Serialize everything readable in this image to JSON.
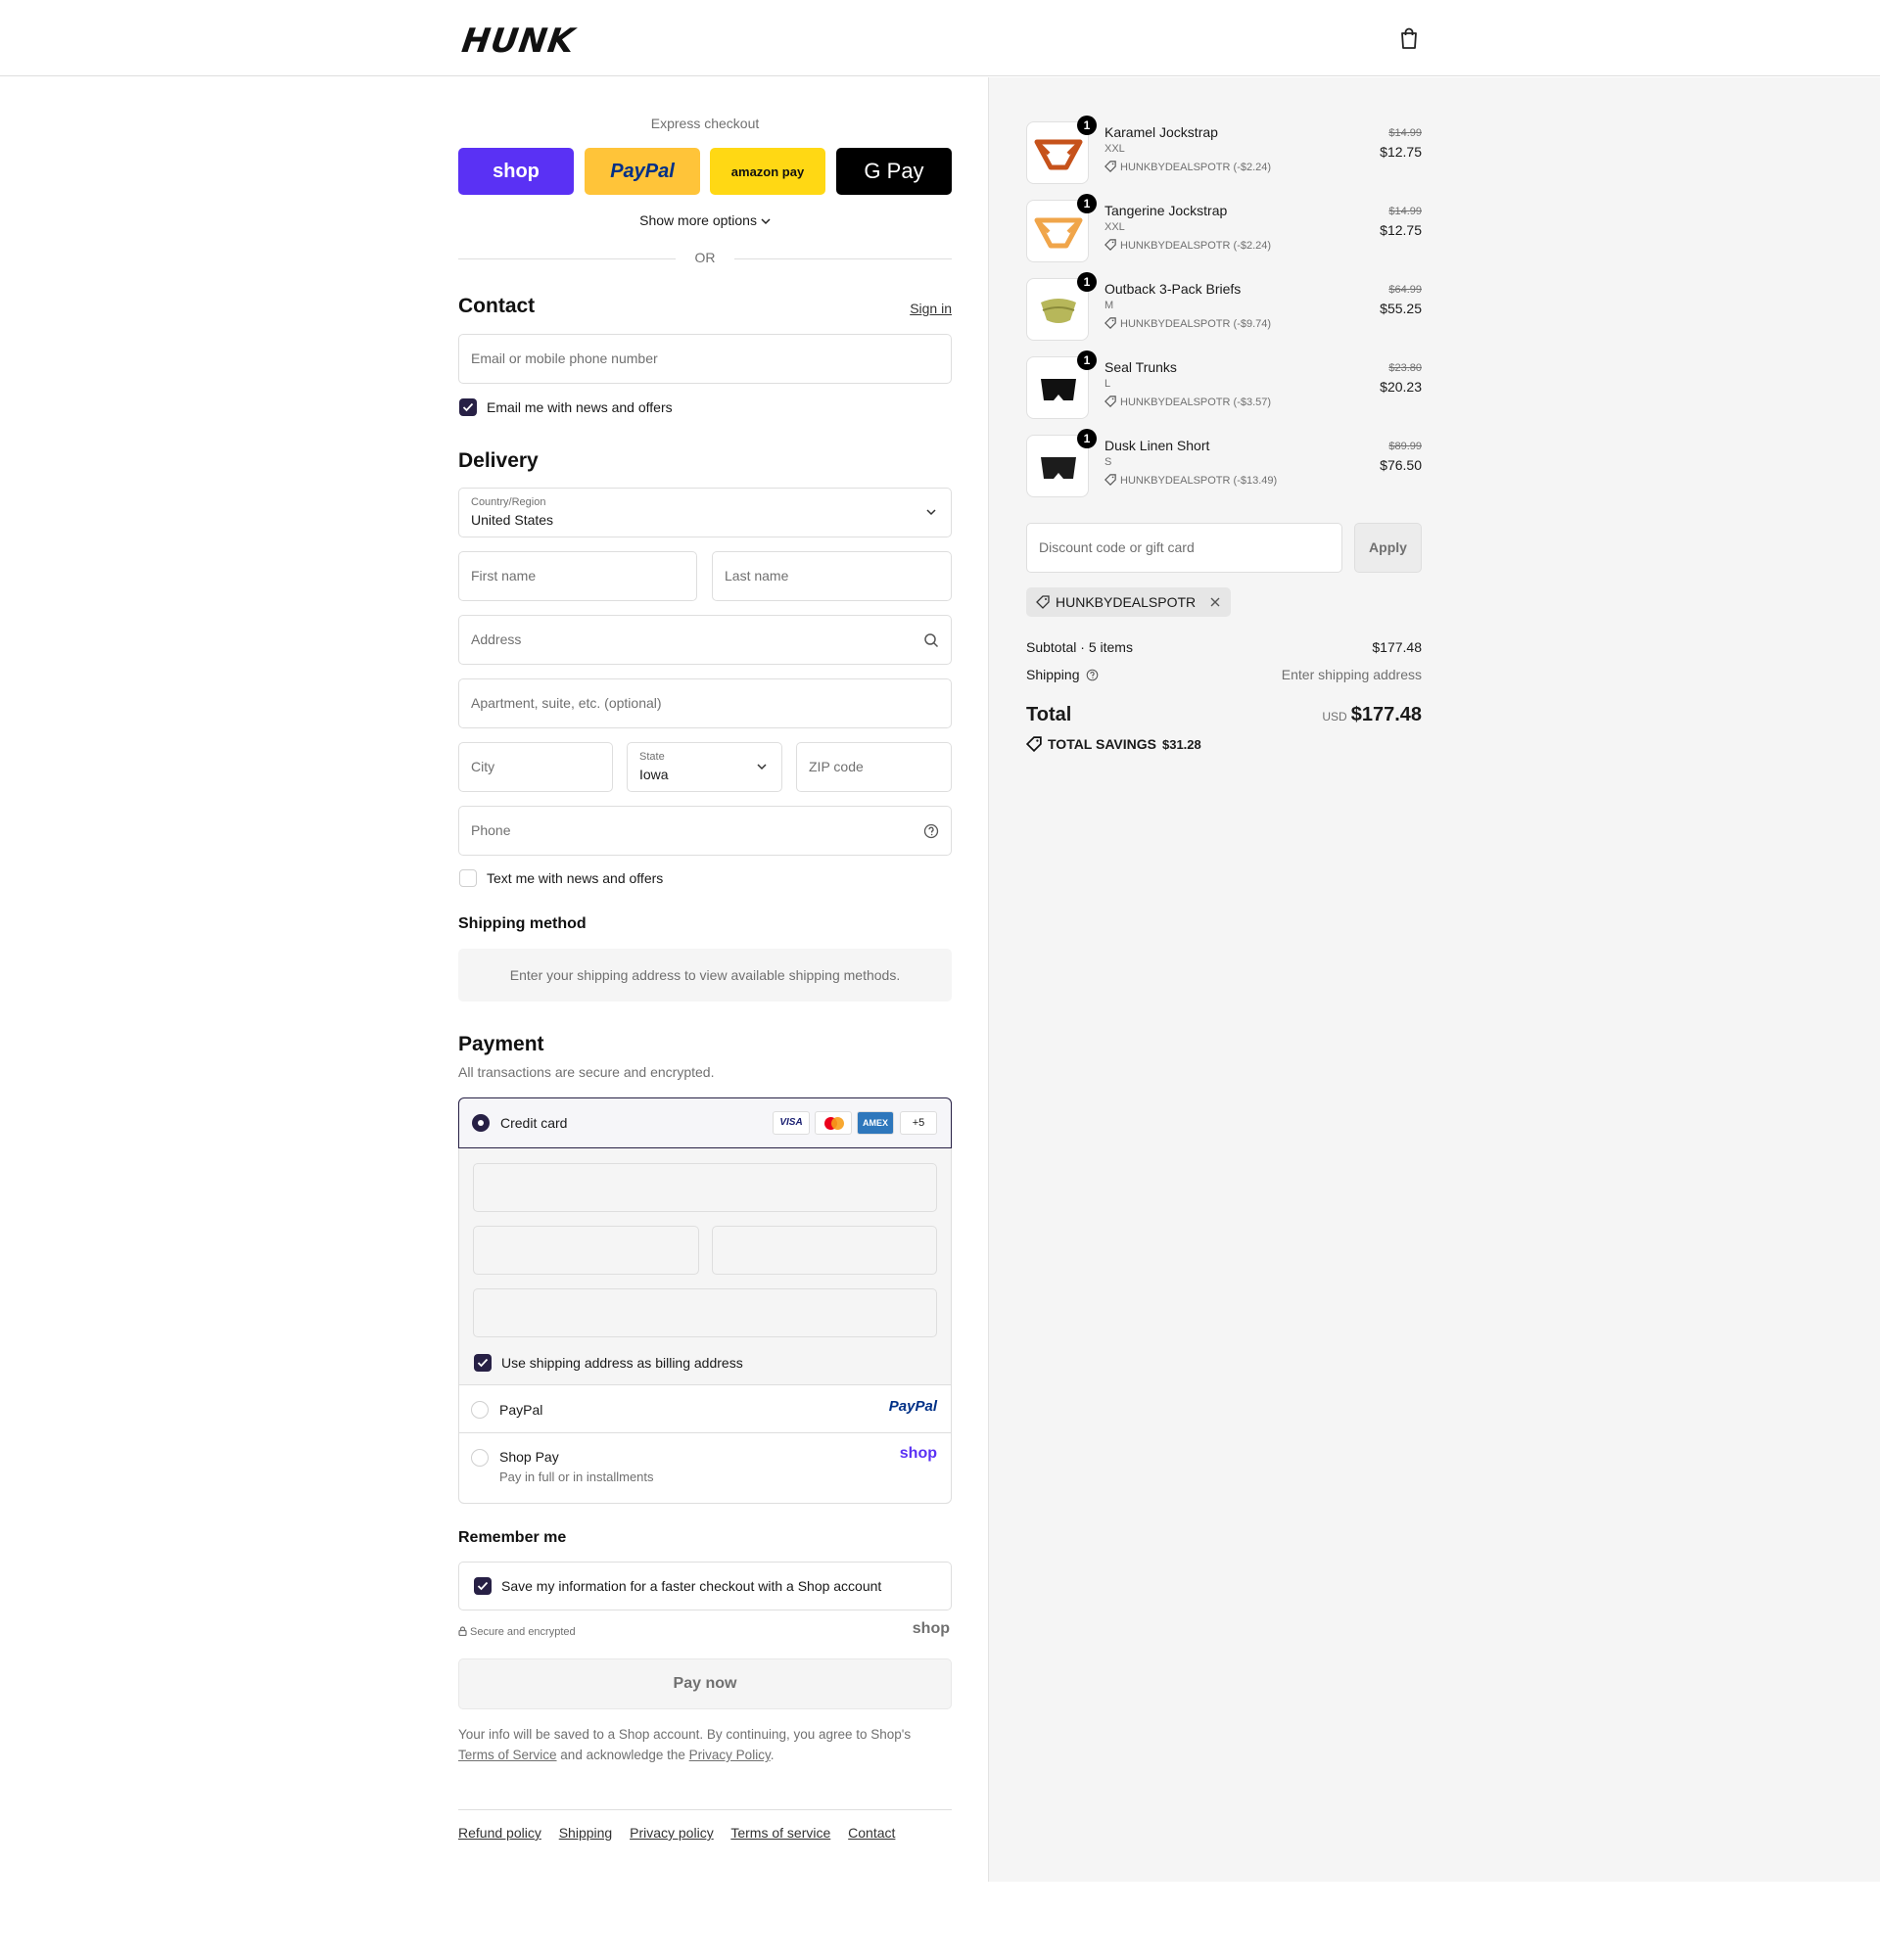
{
  "header": {
    "logo": "HUNK",
    "cart_icon": "shopping-bag-icon"
  },
  "express": {
    "title": "Express checkout",
    "buttons": [
      {
        "label": "shop",
        "bg": "#5a31f4",
        "fg": "#ffffff"
      },
      {
        "label": "PayPal",
        "bg": "#ffc439",
        "fg": "#003087"
      },
      {
        "label": "amazon pay",
        "bg": "#ffd814",
        "fg": "#111111"
      },
      {
        "label": "G Pay",
        "bg": "#000000",
        "fg": "#ffffff"
      }
    ],
    "show_more": "Show more options",
    "or": "OR"
  },
  "contact": {
    "title": "Contact",
    "sign_in": "Sign in",
    "email_placeholder": "Email or mobile phone number",
    "news_label": "Email me with news and offers",
    "news_checked": true
  },
  "delivery": {
    "title": "Delivery",
    "country_label": "Country/Region",
    "country_value": "United States",
    "first_name": "First name",
    "last_name": "Last name",
    "address": "Address",
    "apartment": "Apartment, suite, etc. (optional)",
    "city": "City",
    "state_label": "State",
    "state_value": "Iowa",
    "zip": "ZIP code",
    "phone": "Phone",
    "text_label": "Text me with news and offers",
    "text_checked": false
  },
  "shipping_method": {
    "title": "Shipping method",
    "notice": "Enter your shipping address to view available shipping methods."
  },
  "payment": {
    "title": "Payment",
    "subtitle": "All transactions are secure and encrypted.",
    "credit_card": "Credit card",
    "card_brands": [
      "VISA",
      "mastercard",
      "AMEX",
      "+5"
    ],
    "billing_label": "Use shipping address as billing address",
    "paypal_label": "PayPal",
    "paypal_logo": "PayPal",
    "shoppay_label": "Shop Pay",
    "shoppay_sub": "Pay in full or in installments",
    "shoppay_logo": "shop"
  },
  "remember": {
    "title": "Remember me",
    "save_label": "Save my information for a faster checkout with a Shop account",
    "secure": "Secure and encrypted",
    "shop_logo": "shop"
  },
  "pay_now": "Pay now",
  "legal": {
    "line1": "Your info will be saved to a Shop account. By continuing, you agree to Shop's",
    "tos": "Terms of Service",
    "mid": "and acknowledge the",
    "privacy": "Privacy Policy",
    "end": "."
  },
  "footer": [
    "Refund policy",
    "Shipping",
    "Privacy policy",
    "Terms of service",
    "Contact"
  ],
  "summary": {
    "items": [
      {
        "name": "Karamel Jockstrap",
        "variant": "XXL",
        "discount": "HUNKBYDEALSPOTR (-$2.24)",
        "old": "$14.99",
        "price": "$12.75",
        "qty": "1",
        "color": "#c6521b"
      },
      {
        "name": "Tangerine Jockstrap",
        "variant": "XXL",
        "discount": "HUNKBYDEALSPOTR (-$2.24)",
        "old": "$14.99",
        "price": "$12.75",
        "qty": "1",
        "color": "#f0a54a"
      },
      {
        "name": "Outback 3-Pack Briefs",
        "variant": "M",
        "discount": "HUNKBYDEALSPOTR (-$9.74)",
        "old": "$64.99",
        "price": "$55.25",
        "qty": "1",
        "color": "#b7b75a"
      },
      {
        "name": "Seal Trunks",
        "variant": "L",
        "discount": "HUNKBYDEALSPOTR (-$3.57)",
        "old": "$23.80",
        "price": "$20.23",
        "qty": "1",
        "color": "#111111"
      },
      {
        "name": "Dusk Linen Short",
        "variant": "S",
        "discount": "HUNKBYDEALSPOTR (-$13.49)",
        "old": "$89.99",
        "price": "$76.50",
        "qty": "1",
        "color": "#1c1c1c"
      }
    ],
    "discount_placeholder": "Discount code or gift card",
    "apply": "Apply",
    "applied_code": "HUNKBYDEALSPOTR",
    "subtotal_label": "Subtotal · 5 items",
    "subtotal_value": "$177.48",
    "shipping_label": "Shipping",
    "shipping_value": "Enter shipping address",
    "total_label": "Total",
    "currency": "USD",
    "total_value": "$177.48",
    "savings_label": "TOTAL SAVINGS",
    "savings_value": "$31.28"
  }
}
